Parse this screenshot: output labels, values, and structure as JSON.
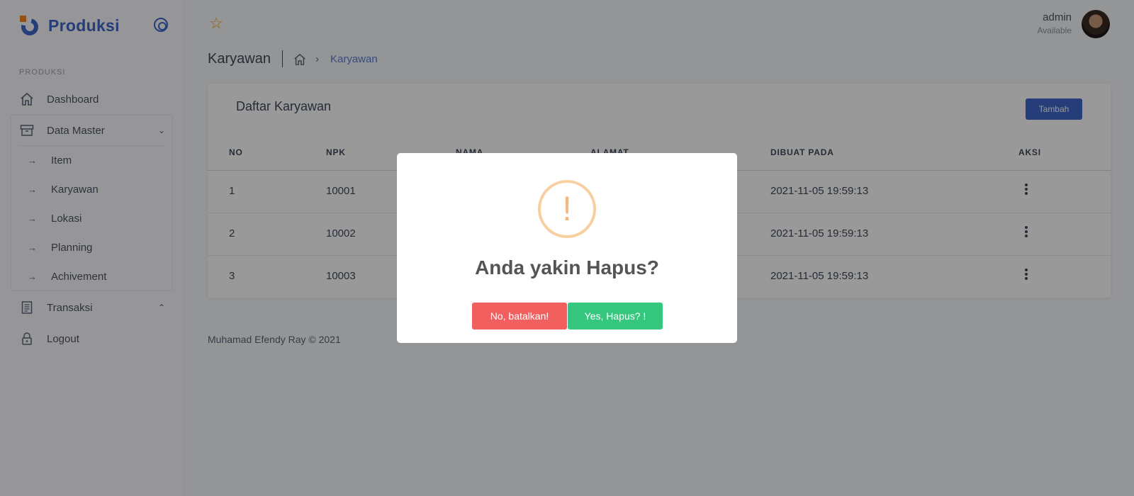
{
  "brand": {
    "name": "Produksi"
  },
  "sidebar": {
    "section_label": "PRODUKSI",
    "items": [
      {
        "label": "Dashboard",
        "icon": "home-icon"
      },
      {
        "label": "Data Master",
        "icon": "archive-icon",
        "expanded": true
      },
      {
        "label": "Transaksi",
        "icon": "document-icon",
        "expanded": false
      },
      {
        "label": "Logout",
        "icon": "lock-icon"
      }
    ],
    "submenu": [
      {
        "label": "Item"
      },
      {
        "label": "Karyawan"
      },
      {
        "label": "Lokasi"
      },
      {
        "label": "Planning"
      },
      {
        "label": "Achivement"
      }
    ]
  },
  "header": {
    "user_name": "admin",
    "user_status": "Available"
  },
  "breadcrumb": {
    "page_title": "Karyawan",
    "current": "Karyawan"
  },
  "card": {
    "title": "Daftar Karyawan",
    "add_button": "Tambah",
    "columns": [
      "NO",
      "NPK",
      "NAMA",
      "ALAMAT",
      "DIBUAT PADA",
      "AKSI"
    ],
    "rows": [
      {
        "no": "1",
        "npk": "10001",
        "created": "2021-11-05 19:59:13"
      },
      {
        "no": "2",
        "npk": "10002",
        "created": "2021-11-05 19:59:13"
      },
      {
        "no": "3",
        "npk": "10003",
        "created": "2021-11-05 19:59:13"
      }
    ]
  },
  "footer": {
    "text": "Muhamad Efendy Ray © 2021"
  },
  "modal": {
    "icon": "!",
    "title": "Anda yakin Hapus?",
    "cancel_label": "No, batalkan!",
    "confirm_label": "Yes, Hapus? !"
  },
  "colors": {
    "brand": "#3f66c9",
    "accent_orange": "#f08a24",
    "cancel": "#f15f5f",
    "confirm": "#36c77f",
    "warning": "#f8cfa0"
  }
}
